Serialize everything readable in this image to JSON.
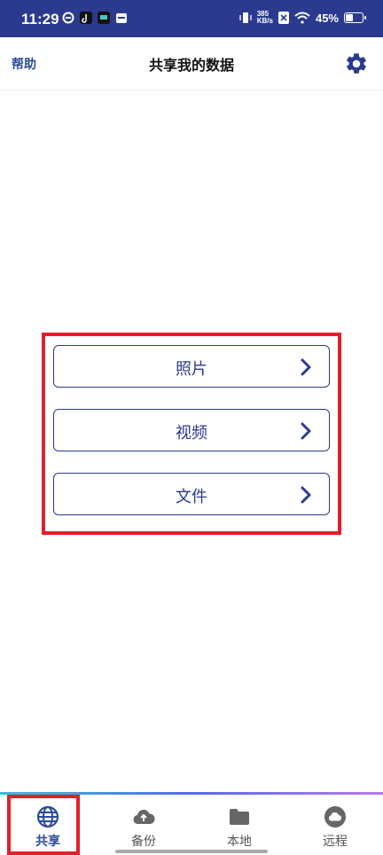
{
  "status_bar": {
    "time": "11:29",
    "net_speed_value": "385",
    "net_speed_unit": "KB/s",
    "battery_percent": "45%",
    "battery_level": 0.45
  },
  "header": {
    "help_label": "帮助",
    "title": "共享我的数据",
    "settings_icon": "gear-icon"
  },
  "menu": {
    "items": [
      {
        "label": "照片"
      },
      {
        "label": "视频"
      },
      {
        "label": "文件"
      }
    ]
  },
  "bottom_nav": {
    "items": [
      {
        "label": "共享",
        "icon": "globe-icon",
        "active": true
      },
      {
        "label": "备份",
        "icon": "cloud-upload-icon",
        "active": false
      },
      {
        "label": "本地",
        "icon": "folder-icon",
        "active": false
      },
      {
        "label": "远程",
        "icon": "cloud-icon",
        "active": false
      }
    ]
  },
  "colors": {
    "primary": "#2b3a8f",
    "highlight": "#e0202a"
  }
}
